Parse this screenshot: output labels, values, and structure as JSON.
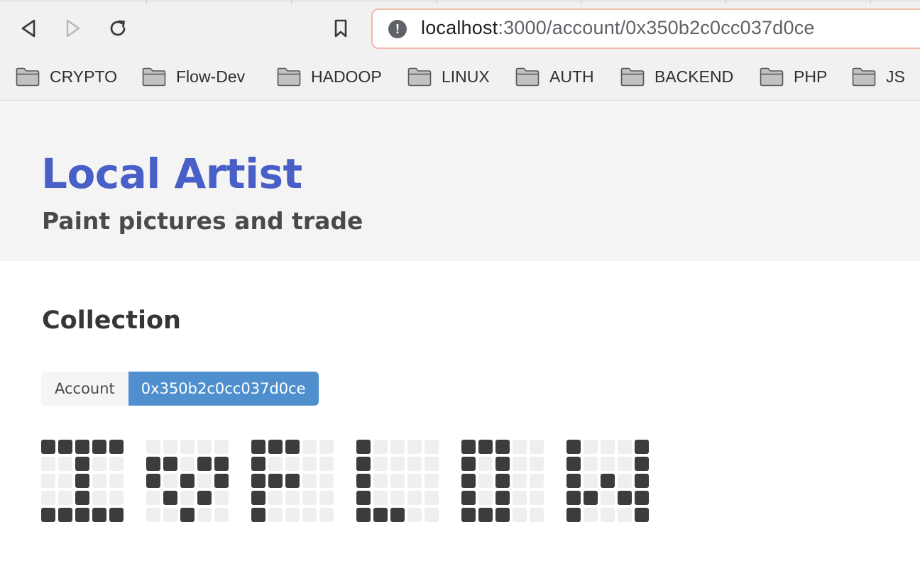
{
  "browser": {
    "url_host": "localhost",
    "url_path": ":3000/account/0x350b2c0cc037d0ce",
    "info_icon": "!",
    "bookmarks": [
      {
        "label": "CRYPTO"
      },
      {
        "label": "Flow-Dev"
      },
      {
        "label": "HADOOP"
      },
      {
        "label": "LINUX"
      },
      {
        "label": "AUTH"
      },
      {
        "label": "BACKEND"
      },
      {
        "label": "PHP"
      },
      {
        "label": "JS"
      }
    ]
  },
  "hero": {
    "title": "Local Artist",
    "subtitle": "Paint pictures and trade"
  },
  "collection": {
    "title": "Collection",
    "account_label": "Account",
    "account_address": "0x350b2c0cc037d0ce",
    "pictures": [
      [
        "11111",
        "00100",
        "00100",
        "00100",
        "11111"
      ],
      [
        "00000",
        "11011",
        "10101",
        "01010",
        "00100"
      ],
      [
        "11100",
        "10000",
        "11100",
        "10000",
        "10000"
      ],
      [
        "10000",
        "10000",
        "10000",
        "10000",
        "11100"
      ],
      [
        "11100",
        "10100",
        "10100",
        "10100",
        "11100"
      ],
      [
        "10001",
        "10001",
        "10101",
        "11011",
        "10001"
      ]
    ]
  },
  "colors": {
    "title_blue": "#485fc7",
    "tag_blue": "#4f8fce",
    "pixel_on": "#3c3c3c",
    "pixel_off": "#efefef",
    "urlbar_border": "#f0b9a8"
  }
}
